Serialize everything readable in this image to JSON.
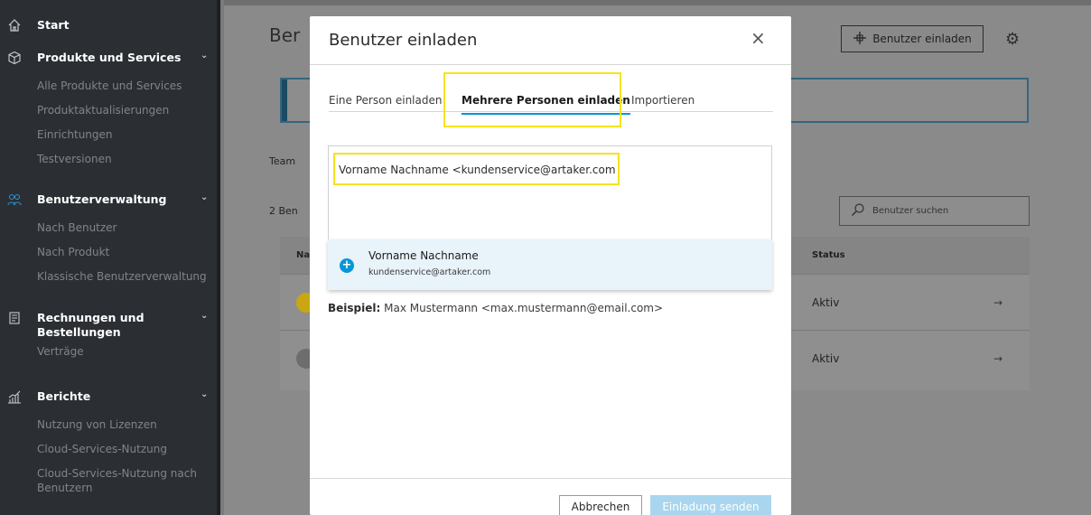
{
  "sidebar": {
    "start": "Start",
    "products": {
      "title": "Produkte und Services",
      "items": [
        "Alle Produkte und Services",
        "Produktaktualisierungen",
        "Einrichtungen",
        "Testversionen"
      ]
    },
    "users": {
      "title": "Benutzerverwaltung",
      "items": [
        "Nach Benutzer",
        "Nach Produkt",
        "Klassische Benutzerverwaltung"
      ]
    },
    "billing": {
      "title_line1": "Rechnungen und",
      "title_line2": "Bestellungen",
      "items": [
        "Verträge"
      ]
    },
    "reports": {
      "title": "Berichte",
      "items": [
        "Nutzung von Lizenzen",
        "Cloud-Services-Nutzung",
        "Cloud-Services-Nutzung nach",
        "Benutzern"
      ]
    }
  },
  "background": {
    "title_partial": "Ber",
    "invite_button": "Benutzer einladen",
    "team_partial": "Team",
    "count_partial": "2 Ben",
    "col_name_partial": "Na",
    "search_placeholder": "Benutzer suchen",
    "status_header": "Status",
    "rows": [
      {
        "status": "Aktiv",
        "arrow": "→"
      },
      {
        "status": "Aktiv",
        "arrow": "→"
      }
    ]
  },
  "modal": {
    "title": "Benutzer einladen",
    "close": "×",
    "tabs": [
      "Eine Person einladen",
      "Mehrere Personen einladen",
      "Importieren"
    ],
    "active_tab": "Mehrere Personen einladen",
    "input_value": "Vorname Nachname <kundenservice@artaker.com",
    "suggestion": {
      "name": "Vorname Nachname",
      "email": "kundenservice@artaker.com"
    },
    "example_label": "Beispiel:",
    "example_text": "Max Mustermann <max.mustermann@email.com>",
    "cancel_button": "Abbrechen",
    "send_button": "Einladung senden"
  },
  "colors": {
    "accent": "#0696d7",
    "highlight": "#f5e31c",
    "sidebar_bg": "#2b2f34"
  }
}
